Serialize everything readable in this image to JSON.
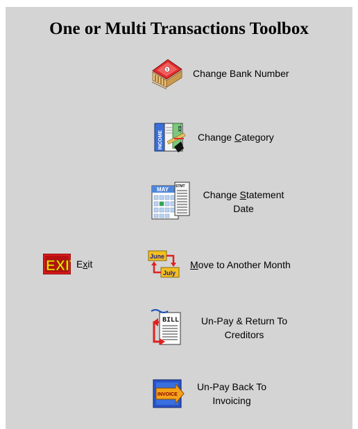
{
  "window": {
    "title": "One or Multi Transactions Toolbox"
  },
  "buttons": {
    "change_bank": {
      "label": "Change Bank Number",
      "icon": "bank-building-icon"
    },
    "change_category": {
      "pre": "Change ",
      "accel": "C",
      "post": "ategory",
      "icon": "income-expense-book-icon"
    },
    "change_statement_date": {
      "pre": "Change ",
      "accel": "S",
      "post": "tatement",
      "line2": "Date",
      "icon": "calendar-statement-icon"
    },
    "move_month": {
      "accel": "M",
      "post": "ove to Another Month",
      "icon": "june-july-arrow-icon",
      "icon_text_top": "June",
      "icon_text_bottom": "July"
    },
    "unpay_creditors": {
      "line1": "Un-Pay & Return To",
      "line2": "Creditors",
      "icon": "bill-return-arrow-icon",
      "icon_text": "BILL"
    },
    "unpay_invoicing": {
      "line1": "Un-Pay Back To",
      "line2": "Invoicing",
      "icon": "invoice-arrow-icon",
      "icon_text": "INVOICE"
    },
    "exit": {
      "pre": "E",
      "accel": "x",
      "post": "it",
      "icon": "exit-sign-icon",
      "icon_text": "EXIT"
    }
  },
  "colors": {
    "panel": "#d4d4d4",
    "exit_red": "#d81c1c",
    "exit_yellow": "#ffd800"
  }
}
